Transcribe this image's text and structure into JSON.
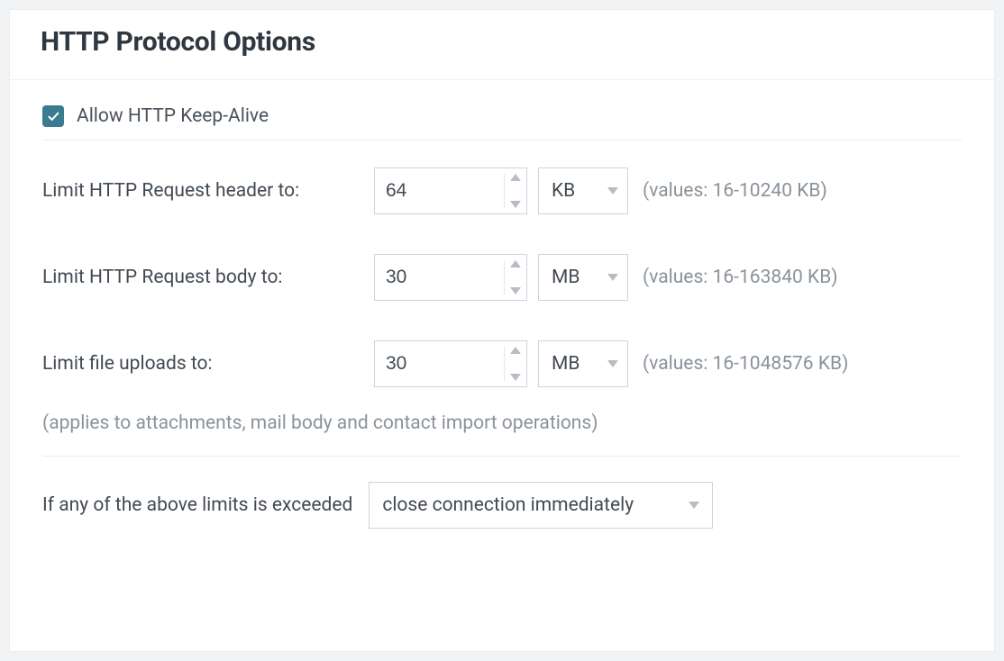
{
  "section": {
    "title": "HTTP Protocol Options"
  },
  "keepAlive": {
    "checked": true,
    "label": "Allow HTTP Keep-Alive"
  },
  "limits": {
    "header": {
      "label": "Limit HTTP Request header to:",
      "value": "64",
      "unit": "KB",
      "hint": "(values: 16-10240 KB)"
    },
    "body": {
      "label": "Limit HTTP Request body to:",
      "value": "30",
      "unit": "MB",
      "hint": "(values: 16-163840 KB)"
    },
    "upload": {
      "label": "Limit file uploads to:",
      "value": "30",
      "unit": "MB",
      "hint": "(values: 16-1048576 KB)"
    },
    "uploadNote": "(applies to attachments, mail body and contact import operations)"
  },
  "exceeded": {
    "label": "If any of the above limits is exceeded",
    "selected": "close connection immediately"
  }
}
